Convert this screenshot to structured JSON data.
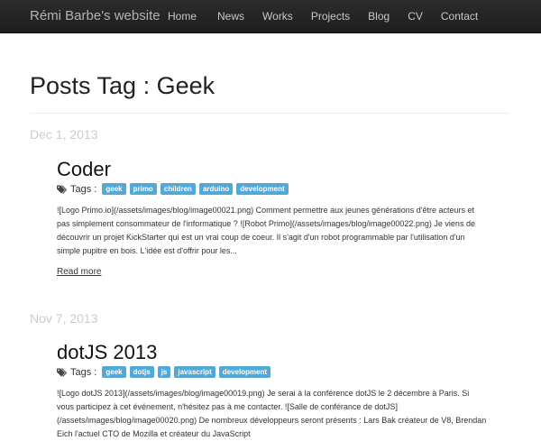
{
  "navbar": {
    "brand": "Rémi Barbe's website",
    "items": [
      {
        "label": "Home"
      },
      {
        "label": "News"
      },
      {
        "label": "Works"
      },
      {
        "label": "Projects"
      },
      {
        "label": "Blog"
      },
      {
        "label": "CV"
      },
      {
        "label": "Contact"
      }
    ]
  },
  "page": {
    "title": "Posts Tag : Geek"
  },
  "posts": [
    {
      "date": "Dec 1, 2013",
      "title": "Coder",
      "tags_label": "Tags :",
      "tags": [
        "geek",
        "primo",
        "children",
        "arduino",
        "development"
      ],
      "excerpt": "![Logo Primo.io](/assets/images/blog/image00021.png) Comment permettre aux jeunes générations d'être acteurs et pas simplement consommateur de l'informatique ? ![Robot Primo](/assets/images/blog/image00022.png) Je viens de découvrir un projet KickStarter qui est un vrai coup de coeur. Il s'agit d'un robot programmable par l'utilisation d'un simple pupitre en bois. L'idée est d'offrir pour les...",
      "read_more": "Read more"
    },
    {
      "date": "Nov 7, 2013",
      "title": "dotJS 2013",
      "tags_label": "Tags :",
      "tags": [
        "geek",
        "dotjs",
        "js",
        "javascript",
        "development"
      ],
      "excerpt": "![Logo dotJS 2013](/assets/images/blog/image00019.png) Je serai à la conférence dotJS le 2 décembre à Paris. Si vous participez à cet événement, n'hésitez pas à me contacter. ![Salle de conférance de dotJS](/assets/images/blog/image00020.png) De nombreux développeurs seront présents : Lars Bak créateur de V8, Brendan Eich l'actuel CTO de Mozilla et créateur du JavaScript"
    }
  ]
}
